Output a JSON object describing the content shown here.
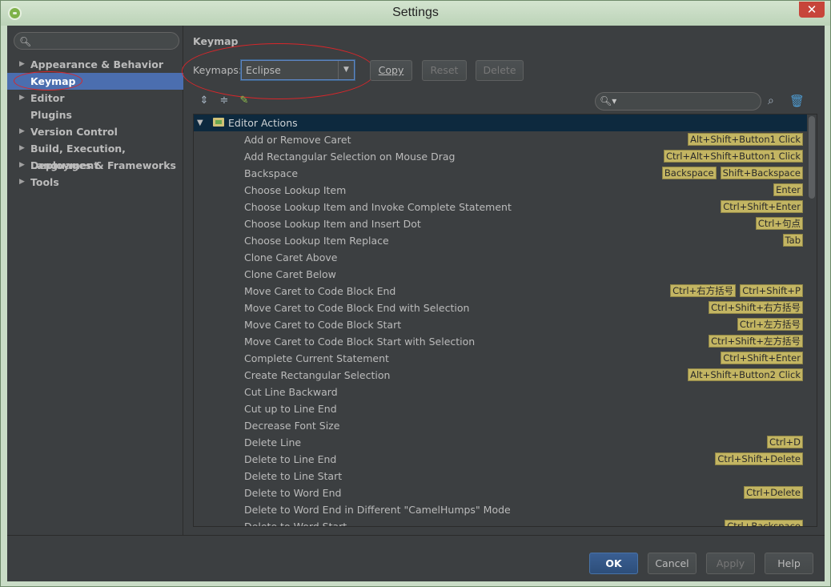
{
  "window": {
    "title": "Settings",
    "close_label": "✕"
  },
  "sidebar": {
    "search_placeholder": "",
    "items": [
      {
        "label": "Appearance & Behavior",
        "expandable": true
      },
      {
        "label": "Keymap",
        "expandable": false,
        "selected": true
      },
      {
        "label": "Editor",
        "expandable": true
      },
      {
        "label": "Plugins",
        "expandable": false
      },
      {
        "label": "Version Control",
        "expandable": true
      },
      {
        "label": "Build, Execution, Deployment",
        "expandable": true
      },
      {
        "label": "Languages & Frameworks",
        "expandable": true
      },
      {
        "label": "Tools",
        "expandable": true
      }
    ]
  },
  "main": {
    "section_title": "Keymap",
    "keymaps_label": "Keymaps:",
    "keymap_value": "Eclipse",
    "buttons": {
      "copy": "Copy",
      "reset": "Reset",
      "delete": "Delete"
    },
    "tree_search_placeholder": ""
  },
  "tree": {
    "group": "Editor Actions",
    "actions": [
      {
        "name": "Add or Remove Caret",
        "shortcuts": [
          "Alt+Shift+Button1 Click"
        ]
      },
      {
        "name": "Add Rectangular Selection on Mouse Drag",
        "shortcuts": [
          "Ctrl+Alt+Shift+Button1 Click"
        ]
      },
      {
        "name": "Backspace",
        "shortcuts": [
          "Backspace",
          "Shift+Backspace"
        ]
      },
      {
        "name": "Choose Lookup Item",
        "shortcuts": [
          "Enter"
        ]
      },
      {
        "name": "Choose Lookup Item and Invoke Complete Statement",
        "shortcuts": [
          "Ctrl+Shift+Enter"
        ]
      },
      {
        "name": "Choose Lookup Item and Insert Dot",
        "shortcuts": [
          "Ctrl+句点"
        ]
      },
      {
        "name": "Choose Lookup Item Replace",
        "shortcuts": [
          "Tab"
        ]
      },
      {
        "name": "Clone Caret Above",
        "shortcuts": []
      },
      {
        "name": "Clone Caret Below",
        "shortcuts": []
      },
      {
        "name": "Move Caret to Code Block End",
        "shortcuts": [
          "Ctrl+右方括号",
          "Ctrl+Shift+P"
        ]
      },
      {
        "name": "Move Caret to Code Block End with Selection",
        "shortcuts": [
          "Ctrl+Shift+右方括号"
        ]
      },
      {
        "name": "Move Caret to Code Block Start",
        "shortcuts": [
          "Ctrl+左方括号"
        ]
      },
      {
        "name": "Move Caret to Code Block Start with Selection",
        "shortcuts": [
          "Ctrl+Shift+左方括号"
        ]
      },
      {
        "name": "Complete Current Statement",
        "shortcuts": [
          "Ctrl+Shift+Enter"
        ]
      },
      {
        "name": "Create Rectangular Selection",
        "shortcuts": [
          "Alt+Shift+Button2 Click"
        ]
      },
      {
        "name": "Cut Line Backward",
        "shortcuts": []
      },
      {
        "name": "Cut up to Line End",
        "shortcuts": []
      },
      {
        "name": "Decrease Font Size",
        "shortcuts": []
      },
      {
        "name": "Delete Line",
        "shortcuts": [
          "Ctrl+D"
        ]
      },
      {
        "name": "Delete to Line End",
        "shortcuts": [
          "Ctrl+Shift+Delete"
        ]
      },
      {
        "name": "Delete to Line Start",
        "shortcuts": []
      },
      {
        "name": "Delete to Word End",
        "shortcuts": [
          "Ctrl+Delete"
        ]
      },
      {
        "name": "Delete to Word End in Different \"CamelHumps\" Mode",
        "shortcuts": []
      },
      {
        "name": "Delete to Word Start",
        "shortcuts": [
          "Ctrl+Backspace"
        ]
      }
    ]
  },
  "footer": {
    "ok": "OK",
    "cancel": "Cancel",
    "apply": "Apply",
    "help": "Help"
  },
  "colors": {
    "selection": "#4b6eaf",
    "shortcut_badge": "#c3b562",
    "annotation": "#d9262a"
  }
}
